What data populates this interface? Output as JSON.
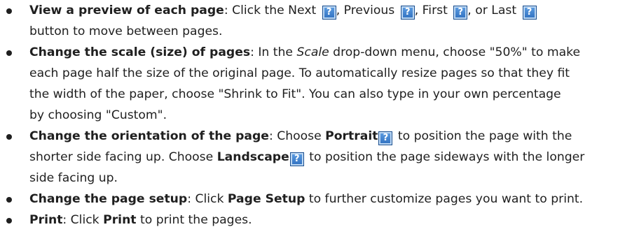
{
  "help_icon_glyph": "?",
  "items": [
    {
      "lines": [
        {
          "title": "View a preview of each page",
          "text1": ": Click the Next ",
          "text2": ", Previous ",
          "text3": ", First ",
          "text4": ", or Last "
        },
        {
          "text": "button to move between pages."
        }
      ]
    },
    {
      "lines": [
        {
          "title": "Change the scale (size) of pages",
          "text1": ": In the ",
          "italic": "Scale",
          "text2": " drop-down menu, choose \"50%\" to make"
        },
        {
          "text": "each page half the size of the original page. To automatically resize pages so that they fit"
        },
        {
          "text": "the width of the paper, choose \"Shrink to Fit\". You can also type in your own percentage"
        },
        {
          "text": "by choosing \"Custom\"."
        }
      ]
    },
    {
      "lines": [
        {
          "title": "Change the orientation of the page",
          "text1": ": Choose ",
          "bold": "Portrait",
          "text2": " to position the page with the"
        },
        {
          "text1": "shorter side facing up. Choose ",
          "bold": "Landscape",
          "text2": " to position the page sideways with the longer"
        },
        {
          "text": "side facing up."
        }
      ]
    },
    {
      "lines": [
        {
          "title": "Change the page setup",
          "text1": ": Click ",
          "bold": "Page Setup",
          "text2": " to further customize pages you want to print."
        }
      ]
    },
    {
      "lines": [
        {
          "title": "Print",
          "text1": ": Click ",
          "bold": "Print",
          "text2": " to print the pages."
        }
      ]
    }
  ]
}
